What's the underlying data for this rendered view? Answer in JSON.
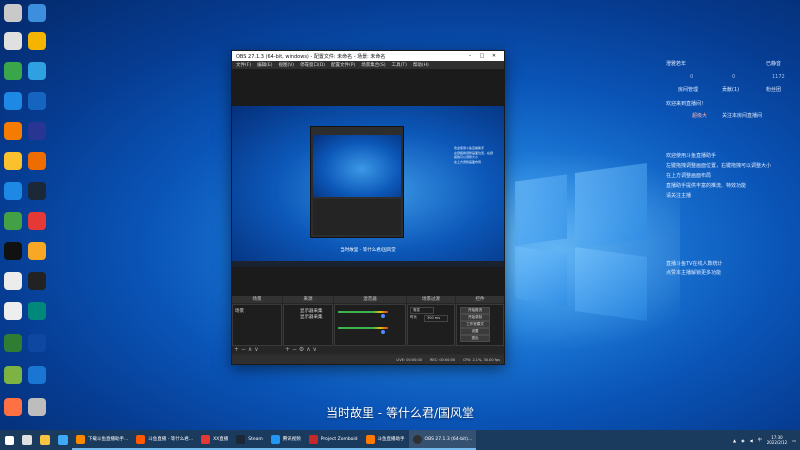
{
  "window": {
    "title": "OBS 27.1.3 (64-bit, windows) - 配置文件: 未命名 - 场景: 未命名",
    "menu": [
      "文件(F)",
      "编辑(E)",
      "视图(V)",
      "停靠窗口(D)",
      "配置文件(P)",
      "场景集合(S)",
      "工具(T)",
      "帮助(H)"
    ]
  },
  "docks": {
    "scenes_header": "场景",
    "scene_item": "场景",
    "sources_header": "来源",
    "source_items": [
      "显示器采集",
      "显示器采集"
    ],
    "mixer_header": "混音器",
    "transitions_header": "场景过渡",
    "transition_value": "渐变",
    "duration_label": "时长",
    "duration_value": "300 ms",
    "controls_header": "控件",
    "controls": [
      "开始推流",
      "开始录制",
      "工作室模式",
      "设置",
      "退出"
    ]
  },
  "status": {
    "live": "LIVE: 00:00:00",
    "rec": "REC: 00:00:00",
    "cpu": "CPU: 2.1%, 30.00 fps"
  },
  "preview": {
    "caption": "当时故里 - 等什么君/国风堂"
  },
  "caption": "当时故里 - 等什么君/国风堂",
  "right_panel": {
    "user": "澄雅若年",
    "status": "已静音",
    "stats": [
      "0",
      "0",
      "1172"
    ],
    "tabs": [
      "房间管理",
      "贡献(1)",
      "粉丝团"
    ],
    "welcome": "欢迎来到直播间！",
    "notice_name": "超级大",
    "notice_text": "关注本房间直播间",
    "tips": [
      "欢迎使用斗鱼直播助手",
      "左键拖拽调整画面位置，右键拖拽可以调整大小",
      "在上方调整画面布局",
      "直播助手提供丰富的推流、特效功能",
      "请关注主播"
    ],
    "footer": [
      "直播斗鱼TV在线人数统计",
      "点赞本主播解锁更多功能"
    ]
  },
  "taskbar": {
    "apps": [
      "下载斗鱼直播助手...",
      "斗鱼直播 - 等什么君...",
      "XX直播",
      "Steam",
      "腾讯视频",
      "Project Zomboid",
      "斗鱼直播助手",
      "OBS 27.1.3 (64-bit)..."
    ],
    "tray_time": "17:30",
    "tray_date": "2022/2/12",
    "tray_label": "中"
  },
  "colors": {
    "taskbar": "#1a3a5e",
    "accent": "#76b9ed",
    "obs_bg": "#2b2b2b"
  }
}
